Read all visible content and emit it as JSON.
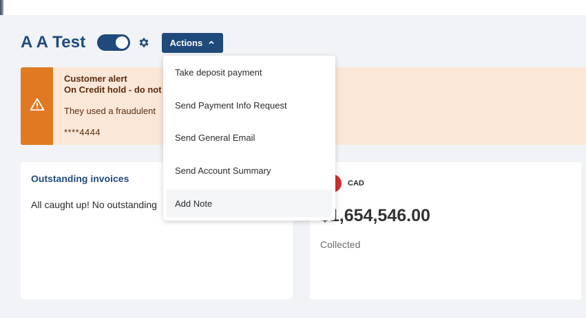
{
  "header": {
    "customer_name": "A A Test",
    "actions_label": "Actions"
  },
  "alert": {
    "title": "Customer alert",
    "subtitle": "On Credit hold - do not",
    "message": "They used a fraudulent",
    "card_number": "****4444"
  },
  "menu": {
    "items": [
      {
        "label": "Take deposit payment"
      },
      {
        "label": "Send Payment Info Request"
      },
      {
        "label": "Send General Email"
      },
      {
        "label": "Send Account Summary"
      },
      {
        "label": "Add Note"
      }
    ]
  },
  "invoices_card": {
    "title": "Outstanding invoices",
    "empty_message": "All caught up! No outstanding"
  },
  "collected_card": {
    "currency": "CAD",
    "amount": "$1,654,546.00",
    "label": "Collected"
  },
  "colors": {
    "brand": "#1f4a7a",
    "alert_strip": "#e07a22",
    "alert_background": "#fbe7d8",
    "flag": "#d0312d"
  },
  "icons": {
    "settings": "gear-icon",
    "alert": "warning-icon",
    "actions_chevron": "chevron-up-icon"
  }
}
